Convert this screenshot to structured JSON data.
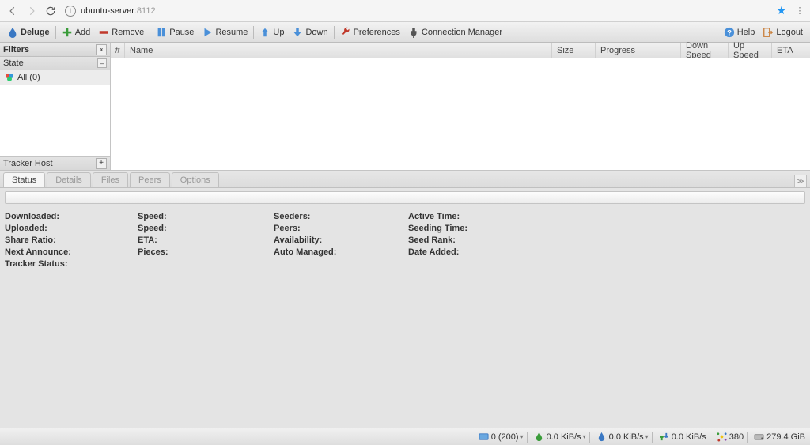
{
  "browser": {
    "host": "ubuntu-server",
    "port": ":8112"
  },
  "toolbar": {
    "app": "Deluge",
    "add": "Add",
    "remove": "Remove",
    "pause": "Pause",
    "resume": "Resume",
    "up": "Up",
    "down": "Down",
    "preferences": "Preferences",
    "conn_mgr": "Connection Manager",
    "help": "Help",
    "logout": "Logout"
  },
  "sidebar": {
    "filters": "Filters",
    "state": "State",
    "all": "All (0)",
    "tracker_host": "Tracker Host"
  },
  "grid": {
    "cols": {
      "num": "#",
      "name": "Name",
      "size": "Size",
      "progress": "Progress",
      "dspeed": "Down Speed",
      "uspeed": "Up Speed",
      "eta": "ETA"
    }
  },
  "tabs": {
    "status": "Status",
    "details": "Details",
    "files": "Files",
    "peers": "Peers",
    "options": "Options"
  },
  "stats": {
    "downloaded": "Downloaded:",
    "speed1": "Speed:",
    "seeders": "Seeders:",
    "active_time": "Active Time:",
    "uploaded": "Uploaded:",
    "speed2": "Speed:",
    "peers": "Peers:",
    "seeding_time": "Seeding Time:",
    "share_ratio": "Share Ratio:",
    "eta": "ETA:",
    "availability": "Availability:",
    "seed_rank": "Seed Rank:",
    "next_announce": "Next Announce:",
    "pieces": "Pieces:",
    "auto_managed": "Auto Managed:",
    "date_added": "Date Added:",
    "tracker_status": "Tracker Status:"
  },
  "statusbar": {
    "conns": "0 (200)",
    "dl": "0.0 KiB/s",
    "ul": "0.0 KiB/s",
    "proto": "0.0 KiB/s",
    "dht": "380",
    "disk": "279.4 GiB"
  }
}
